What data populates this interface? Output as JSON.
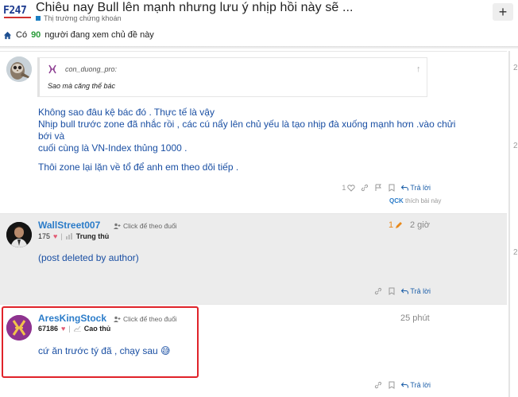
{
  "header": {
    "logo_text": "F247",
    "title": "Chiêu nay Bull lên mạnh nhưng lưu ý nhịp hồi này sẽ ...",
    "category": "Thị trường chứng khoán",
    "plus_label": "+",
    "viewers_prefix": "Có",
    "viewers_count": "90",
    "viewers_suffix": "người đang xem chủ đề này"
  },
  "timeline": {
    "marks": [
      "2",
      "2",
      "2"
    ]
  },
  "posts": [
    {
      "quote": {
        "author": "con_duong_pro:",
        "text": "Sao mà căng thế bác"
      },
      "lines": [
        "Không sao đâu kệ bác đó . Thực tế là vậy",
        "Nhịp bull trước zone đã nhắc rồi , các cú nẩy lên chủ yếu là tạo nhịp đà xuống mạnh hơn .vào chửi bới và",
        "cuối cùng là VN-Index thủng 1000 .",
        "Thôi zone lại lặn về tổ để anh em theo dõi tiếp ."
      ],
      "like_count": "1",
      "reply_label": "Trả lời",
      "liked_by_user": "QCK",
      "liked_by_text": "thích bài này"
    },
    {
      "username": "WallStreet007",
      "follow_label": "Click để theo đuổi",
      "score": "175",
      "rank": "Trung thủ",
      "edit_count": "1",
      "time": "2 giờ",
      "text": "(post deleted by author)",
      "reply_label": "Trả lời"
    },
    {
      "username": "AresKingStock",
      "follow_label": "Click để theo đuổi",
      "score": "67186",
      "rank": "Cao thủ",
      "time": "25 phút",
      "text": "cứ ăn trước tý đã , chạy sau 😅",
      "reply_label": "Trả lời"
    }
  ],
  "colors": {
    "accent": "#2b7cc9",
    "post_text": "#1a4fa3",
    "highlight": "#e0232a",
    "heart": "#e25a73",
    "viewers_count": "#2a9d3a"
  }
}
